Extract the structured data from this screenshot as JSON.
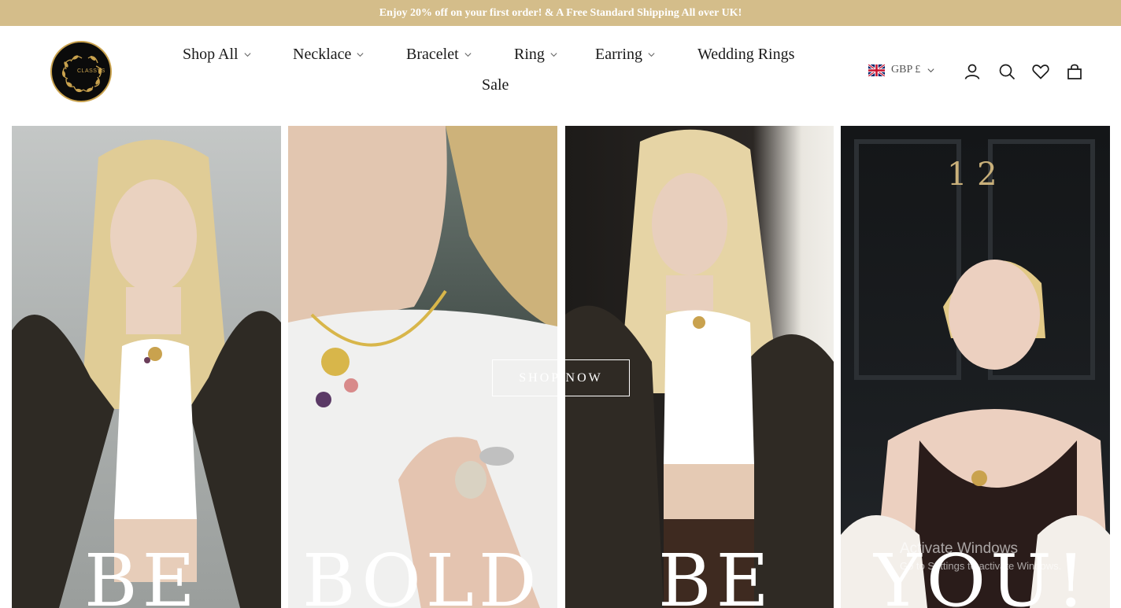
{
  "announcement": "Enjoy 20% off on your first order! & A Free Standard Shipping All over UK!",
  "logo": {
    "text": "CLASSYS"
  },
  "nav": {
    "items": [
      {
        "label": "Shop All",
        "dropdown": true
      },
      {
        "label": "Necklace",
        "dropdown": true
      },
      {
        "label": "Bracelet",
        "dropdown": true
      },
      {
        "label": "Ring",
        "dropdown": true
      },
      {
        "label": "Earring",
        "dropdown": true
      },
      {
        "label": "Wedding Rings",
        "dropdown": false
      },
      {
        "label": "Sale",
        "dropdown": false
      }
    ]
  },
  "header_actions": {
    "currency": "GBP £",
    "icons": [
      "uk-flag-icon",
      "account-icon",
      "search-icon",
      "wishlist-heart-icon",
      "cart-bag-icon"
    ]
  },
  "hero": {
    "words": [
      "BE",
      "BOLD",
      "BE",
      "YOU!"
    ],
    "cta": "SHOP NOW"
  },
  "os_watermark": {
    "title": "Activate Windows",
    "subtitle": "Go to Settings to activate Windows."
  },
  "colors": {
    "announcement_bg": "#d4bd8a",
    "brand_gold": "#c9a24e",
    "text": "#1a1a1a"
  }
}
